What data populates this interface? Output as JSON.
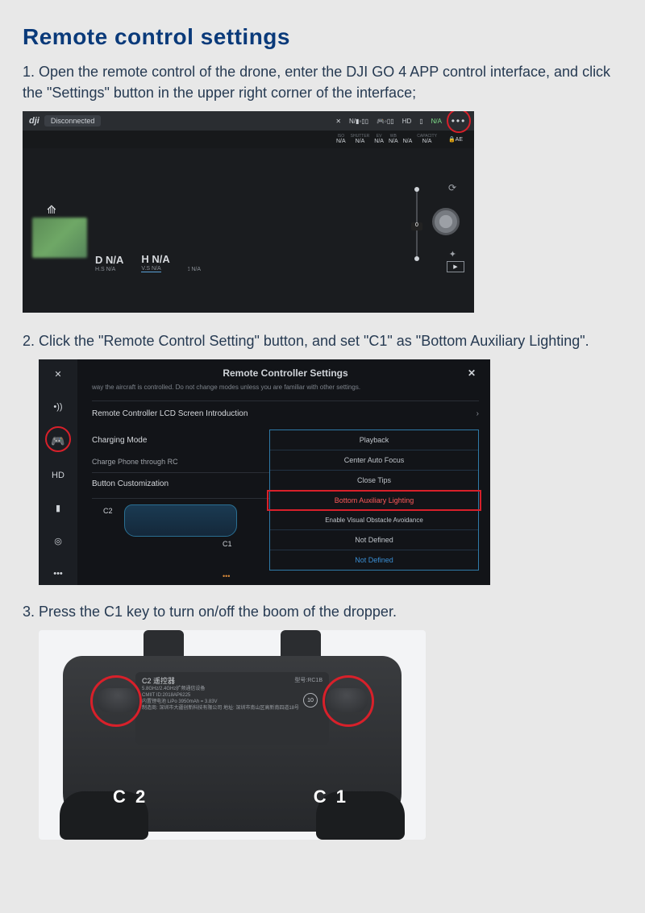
{
  "title": "Remote control settings",
  "steps": {
    "s1": "1. Open the remote control of the drone, enter the DJI GO 4 APP control interface, and click the \"Settings\" button in the upper right corner of the interface;",
    "s2": "2. Click the \"Remote Control Setting\" button, and set \"C1\" as \"Bottom Auxiliary Lighting\".",
    "s3": "3. Press the C1 key to turn on/off the boom of the dropper."
  },
  "shot1": {
    "logo": "dji",
    "status": "Disconnected",
    "topbar": {
      "hd_label": "HD",
      "na_green": "N/A"
    },
    "strip2": {
      "labels": [
        "ISO",
        "SHUTTER",
        "EV",
        "WB",
        "",
        "CAPACITY"
      ],
      "values": [
        "N/A",
        "N/A",
        "N/A",
        "N/A",
        "N/A",
        "N/A"
      ],
      "ae": "AE"
    },
    "slider_value": "0",
    "metrics": {
      "d_label": "D",
      "d_val": "N/A",
      "h_label": "H",
      "h_val": "N/A",
      "hs_label": "H.S",
      "hs_val": "N/A",
      "vs_label": "V.S",
      "vs_val": "N/A",
      "t_val": "N/A"
    }
  },
  "shot2": {
    "side_labels": {
      "hd": "HD"
    },
    "title": "Remote Controller Settings",
    "subtitle": "way the aircraft is controlled. Do not change modes unless you are familiar with other settings.",
    "row_lcd": "Remote Controller LCD Screen Introduction",
    "charging_mode": "Charging Mode",
    "charge_phone": "Charge Phone through RC",
    "button_custom": "Button Customization",
    "c2_label": "C2",
    "c1_label": "C1",
    "c1_col": "C1",
    "options": {
      "o1": "Playback",
      "o2": "Center Auto Focus",
      "o3": "Close Tips",
      "o4": "Bottom Auxiliary Lighting",
      "o5": "Enable Visual Obstacle Avoidance",
      "o6": "Not Defined",
      "o7": "Not Defined"
    }
  },
  "shot3": {
    "brand": "C2 遥控器",
    "model": "型号:RC1B",
    "spec_line1": "5.8GHz/2.4GHz扩频通信设备",
    "spec_line2": "CMIIT ID:2018AP6225",
    "spec_line3": "内置锂电池 LiPo 3950mAh = 3.83V",
    "mfr": "制造商: 深圳市大疆创新科技有限公司  地址: 深圳市南山区高新南四道18号",
    "age": "10",
    "c2": "C 2",
    "c1": "C 1"
  }
}
